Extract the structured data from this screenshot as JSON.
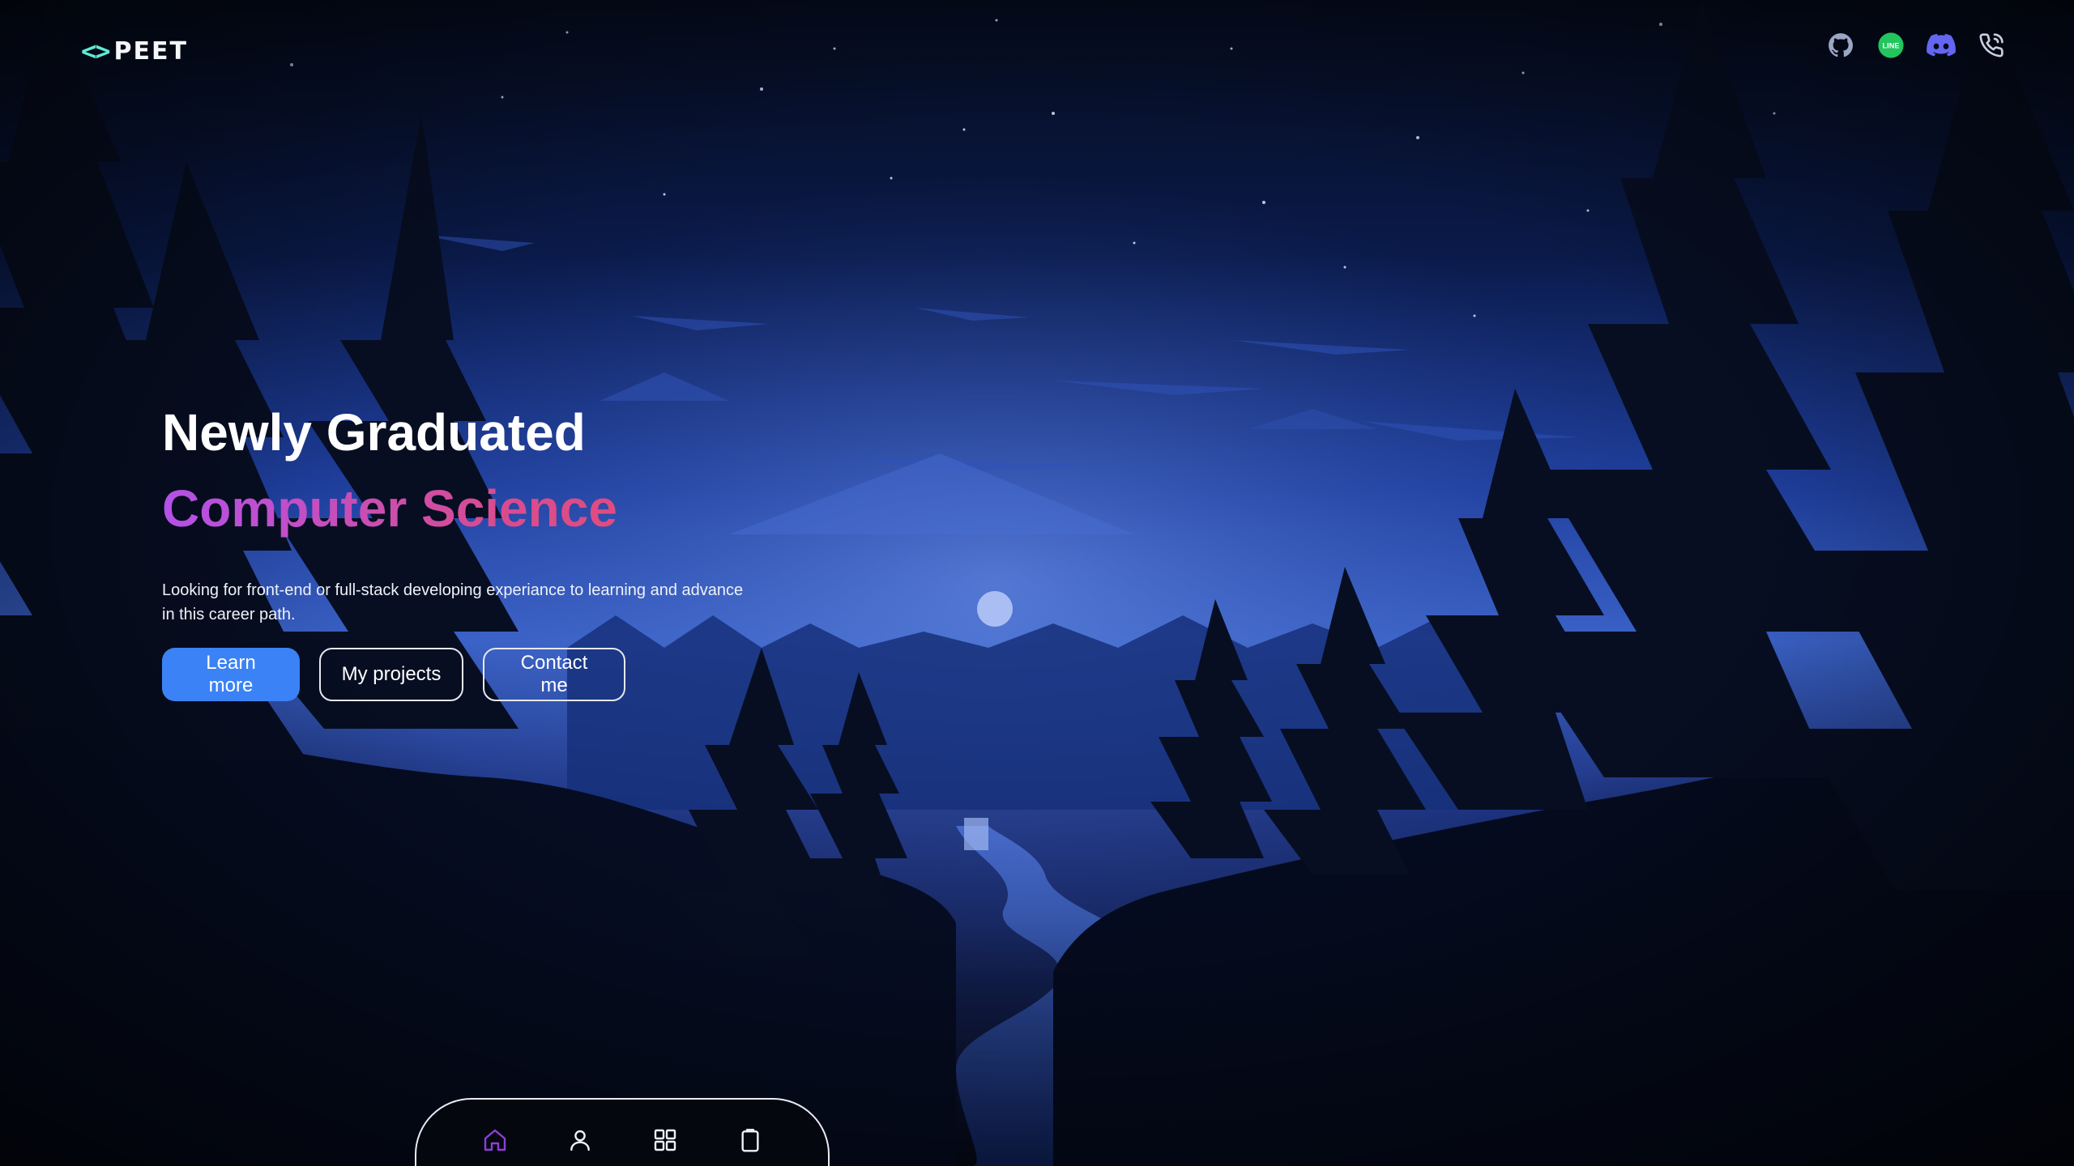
{
  "header": {
    "logo_brackets": "<>",
    "logo_text": "PEET",
    "socials": [
      {
        "icon": "github-icon"
      },
      {
        "icon": "line-icon",
        "label": "LINE"
      },
      {
        "icon": "discord-icon"
      },
      {
        "icon": "phone-icon"
      }
    ]
  },
  "hero": {
    "title": "Newly Graduated",
    "subtitle": "Computer Science",
    "description": "Looking for front-end or full-stack developing experiance to learning and advance in this career path.",
    "buttons": {
      "learn_more": "Learn more",
      "projects": "My projects",
      "contact": "Contact me"
    }
  },
  "bottom_nav": {
    "items": [
      {
        "icon": "home-icon",
        "active": true
      },
      {
        "icon": "user-icon",
        "active": false
      },
      {
        "icon": "grid-icon",
        "active": false
      },
      {
        "icon": "clipboard-icon",
        "active": false
      }
    ]
  },
  "colors": {
    "accent_blue": "#3b82f6",
    "logo_teal": "#5eead4",
    "gradient_start": "#b351e8",
    "gradient_end": "#ee4d6a",
    "nav_active": "#8b3fd6",
    "line_green": "#22c55e",
    "discord_purple": "#6366f1"
  }
}
